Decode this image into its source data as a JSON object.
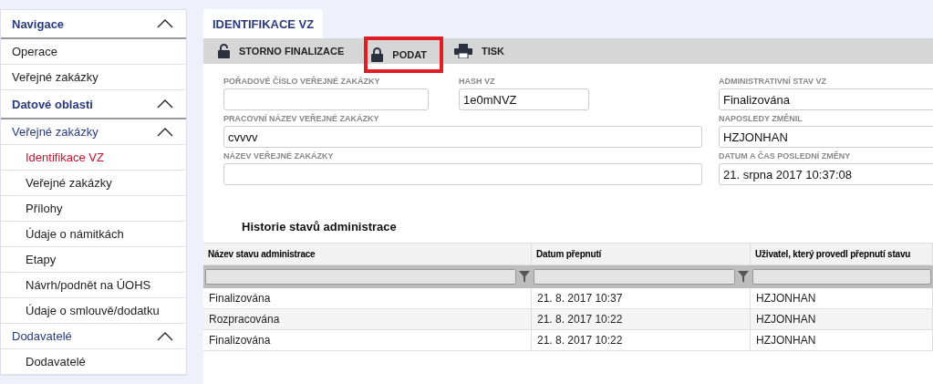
{
  "sidebar": {
    "sections": [
      {
        "title": "Navigace",
        "expanded": true,
        "items": [
          {
            "label": "Operace",
            "selected": false
          },
          {
            "label": "Veřejné zakázky",
            "selected": false
          }
        ]
      },
      {
        "title": "Datové oblasti",
        "expanded": true,
        "items": [
          {
            "label": "Veřejné zakázky",
            "selected": false,
            "expanded": true,
            "children": [
              {
                "label": "Identifikace VZ",
                "selected": true
              },
              {
                "label": "Veřejné zakázky",
                "selected": false
              },
              {
                "label": "Přílohy",
                "selected": false
              },
              {
                "label": "Údaje o námitkách",
                "selected": false
              },
              {
                "label": "Etapy",
                "selected": false
              },
              {
                "label": "Návrh/podnět na ÚOHS",
                "selected": false
              },
              {
                "label": "Údaje o smlouvě/dodatku",
                "selected": false
              }
            ]
          },
          {
            "label": "Dodavatelé",
            "selected": false,
            "expanded": true,
            "children": [
              {
                "label": "Dodavatelé",
                "selected": false
              }
            ]
          }
        ]
      }
    ]
  },
  "tab": {
    "label": "IDENTIFIKACE VZ",
    "selected": true
  },
  "toolbar": [
    {
      "label": "STORNO FINALIZACE",
      "highlighted": false
    },
    {
      "label": "PODAT",
      "highlighted": true
    },
    {
      "label": "TISK",
      "highlighted": false
    }
  ],
  "form": {
    "left": [
      {
        "label": "POŘADOVÉ ČÍSLO VEŘEJNÉ ZAKÁZKY",
        "kind": "pair",
        "second": {
          "label": "HASH VZ",
          "value": "1e0mNVZ"
        }
      },
      {
        "label": "PRACOVNÍ NÁZEV VEŘEJNÉ ZAKÁZKY",
        "value": "cvvvv",
        "kind": "wide"
      },
      {
        "label": "NÁZEV VEŘEJNÉ ZAKÁZKY",
        "kind": "wide"
      }
    ],
    "right": [
      {
        "label": "ADMINISTRATIVNÍ STAV VZ",
        "value": "Finalizována"
      },
      {
        "label": "NAPOSLEDY ZMĚNIL",
        "value": "HZJONHAN"
      },
      {
        "label": "DATUM A ČAS POSLEDNÍ ZMĚNY",
        "value": "21. srpna 2017 10:37:08"
      }
    ]
  },
  "history": {
    "title": "Historie stavů administrace",
    "columns": [
      "Název stavu administrace",
      "Datum přepnutí",
      "Uživatel, který provedl přepnutí stavu"
    ],
    "rows": [
      [
        "Finalizována",
        "21. 8. 2017 10:37",
        "HZJONHAN"
      ],
      [
        "Rozpracována",
        "21. 8. 2017 10:22",
        "HZJONHAN"
      ],
      [
        "Finalizována",
        "21. 8. 2017 10:22",
        "HZJONHAN"
      ]
    ]
  }
}
